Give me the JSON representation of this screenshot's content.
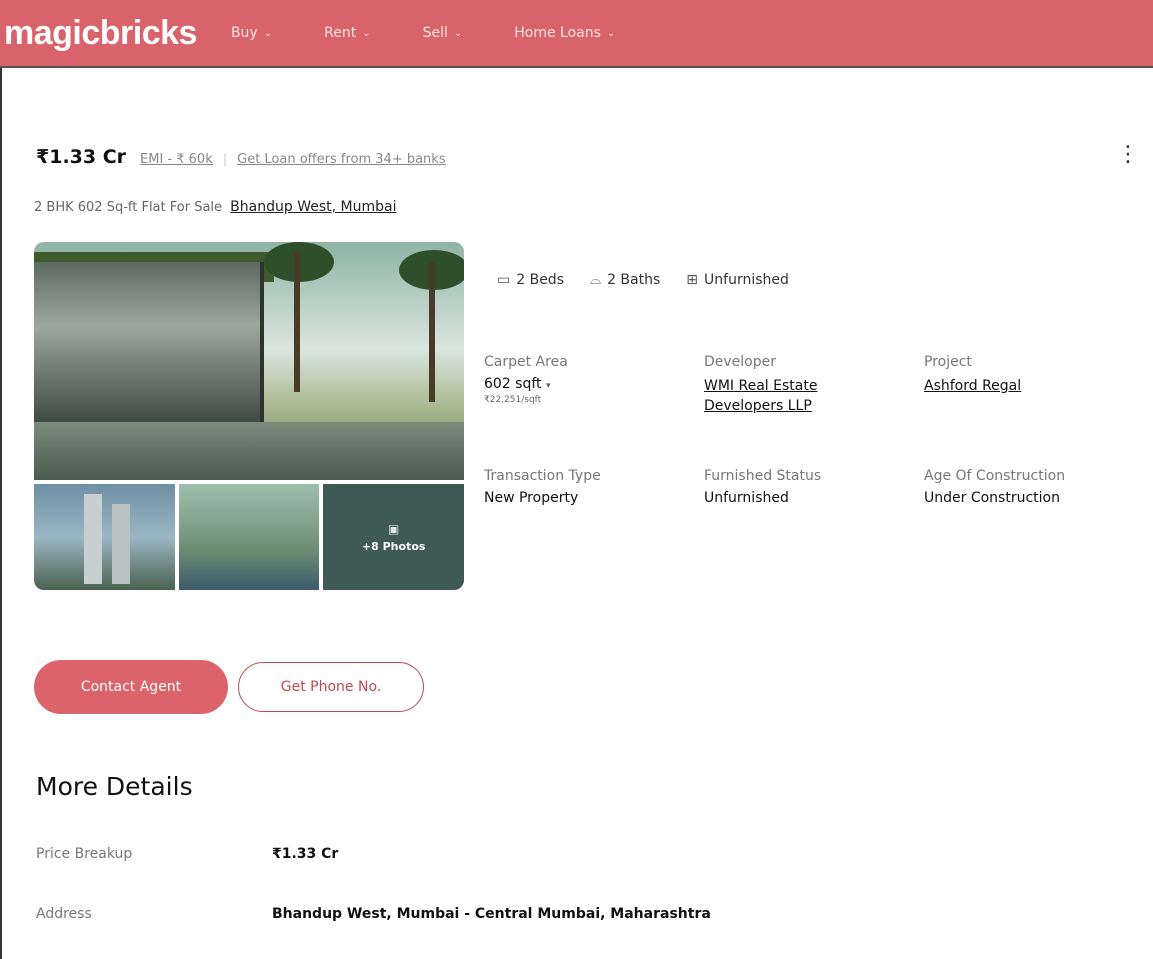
{
  "header": {
    "logo": "magicbricks",
    "nav": [
      {
        "label": "Buy"
      },
      {
        "label": "Rent"
      },
      {
        "label": "Sell"
      },
      {
        "label": "Home Loans"
      }
    ],
    "brand_color": "#d9636b"
  },
  "listing": {
    "price": "₹1.33 Cr",
    "emi": "EMI - ₹ 60k",
    "loan_link": "Get Loan offers from 34+ banks",
    "subtitle": "2 BHK 602 Sq-ft Flat For Sale",
    "location": "Bhandup West, Mumbai",
    "more_photos": "+8 Photos",
    "specs": [
      {
        "icon": "bed-icon",
        "label": "2 Beds"
      },
      {
        "icon": "bath-icon",
        "label": "2 Baths"
      },
      {
        "icon": "furnish-icon",
        "label": "Unfurnished"
      }
    ],
    "details": {
      "carpet_area": {
        "label": "Carpet Area",
        "value": "602 sqft",
        "sub": "₹22,251/sqft"
      },
      "developer": {
        "label": "Developer",
        "value_line1": "WMI Real Estate",
        "value_line2": "Developers LLP"
      },
      "project": {
        "label": "Project",
        "value": "Ashford Regal"
      },
      "transaction": {
        "label": "Transaction Type",
        "value": "New Property"
      },
      "furnished": {
        "label": "Furnished Status",
        "value": "Unfurnished"
      },
      "age": {
        "label": "Age Of Construction",
        "value": "Under Construction"
      }
    },
    "buttons": {
      "contact": "Contact Agent",
      "phone": "Get Phone No."
    }
  },
  "more_details": {
    "title": "More Details",
    "rows": [
      {
        "label": "Price Breakup",
        "value": "₹1.33 Cr"
      },
      {
        "label": "Address",
        "value": "Bhandup West, Mumbai - Central Mumbai, Maharashtra"
      }
    ]
  }
}
